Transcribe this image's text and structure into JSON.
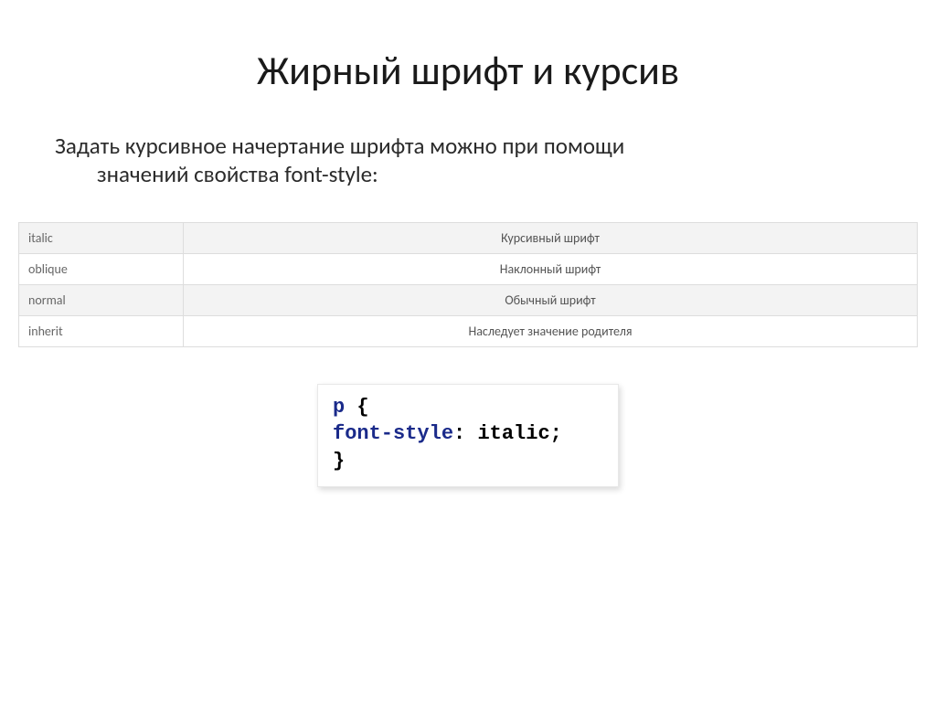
{
  "title": "Жирный шрифт и курсив",
  "intro_line1": "Задать курсивное начертание шрифта можно при помощи",
  "intro_line2": "значений свойства font-style:",
  "table": [
    {
      "key": "italic",
      "desc": "Курсивный шрифт"
    },
    {
      "key": "oblique",
      "desc": "Наклонный шрифт"
    },
    {
      "key": "normal",
      "desc": "Обычный шрифт"
    },
    {
      "key": "inherit",
      "desc": "Наследует значение родителя"
    }
  ],
  "code": {
    "selector": "p",
    "open": "{",
    "property": "font-style",
    "colon": ":",
    "value": "italic",
    "semi": ";",
    "close": "}"
  }
}
